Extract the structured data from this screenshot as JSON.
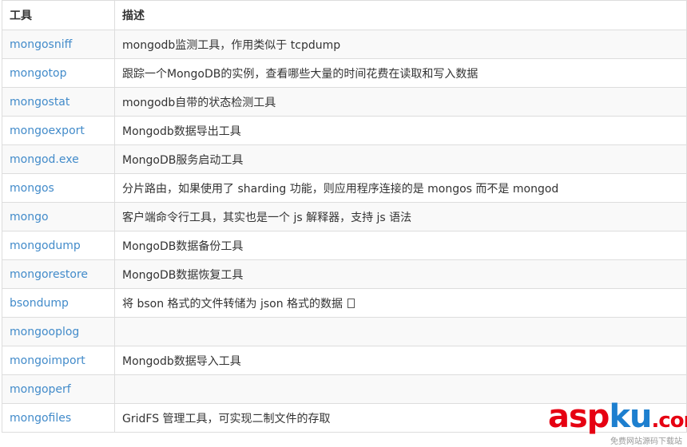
{
  "header": {
    "col1": "工具",
    "col2": "描述"
  },
  "rows": [
    {
      "tool": "mongosniff",
      "desc": "mongodb监测工具，作用类似于 tcpdump"
    },
    {
      "tool": "mongotop",
      "desc": "跟踪一个MongoDB的实例，查看哪些大量的时间花费在读取和写入数据"
    },
    {
      "tool": "mongostat",
      "desc": "mongodb自带的状态检测工具"
    },
    {
      "tool": "mongoexport",
      "desc": "Mongodb数据导出工具"
    },
    {
      "tool": "mongod.exe",
      "desc": "MongoDB服务启动工具"
    },
    {
      "tool": "mongos",
      "desc": "分片路由，如果使用了 sharding 功能，则应用程序连接的是 mongos 而不是 mongod"
    },
    {
      "tool": "mongo",
      "desc": "客户端命令行工具，其实也是一个 js 解释器，支持 js 语法"
    },
    {
      "tool": "mongodump",
      "desc": "MongoDB数据备份工具"
    },
    {
      "tool": "mongorestore",
      "desc": "MongoDB数据恢复工具"
    },
    {
      "tool": "bsondump",
      "desc": "将 bson 格式的文件转储为 json 格式的数据"
    },
    {
      "tool": "mongooplog",
      "desc": ""
    },
    {
      "tool": "mongoimport",
      "desc": "Mongodb数据导入工具"
    },
    {
      "tool": "mongoperf",
      "desc": ""
    },
    {
      "tool": "mongofiles",
      "desc": "GridFS 管理工具，可实现二制文件的存取"
    }
  ],
  "watermark": {
    "part1": "asp",
    "part2": "ku",
    "part3": ".com",
    "sub": "免费网站源码下载站"
  },
  "colors": {
    "link": "#428bca",
    "text": "#333333",
    "border": "#dddddd",
    "stripe": "#f9f9f9",
    "wm_red": "#e60012",
    "wm_blue": "#1d7fcf"
  }
}
